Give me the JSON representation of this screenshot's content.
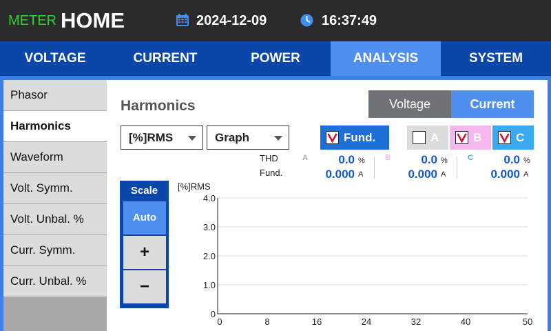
{
  "header": {
    "app": "METER",
    "title": "HOME",
    "date": "2024-12-09",
    "time": "16:37:49"
  },
  "tabs": [
    {
      "label": "VOLTAGE"
    },
    {
      "label": "CURRENT"
    },
    {
      "label": "POWER"
    },
    {
      "label": "ANALYSIS",
      "active": true
    },
    {
      "label": "SYSTEM"
    }
  ],
  "sidebar": {
    "items": [
      {
        "label": "Phasor"
      },
      {
        "label": "Harmonics",
        "active": true
      },
      {
        "label": "Waveform"
      },
      {
        "label": "Volt. Symm."
      },
      {
        "label": "Volt. Unbal. %"
      },
      {
        "label": "Curr. Symm."
      },
      {
        "label": "Curr. Unbal. %"
      }
    ]
  },
  "page": {
    "title": "Harmonics",
    "toggle": {
      "voltage": "Voltage",
      "current": "Current",
      "selected": "Current"
    }
  },
  "controls": {
    "measure_select": "[%]RMS",
    "view_select": "Graph",
    "checks": [
      {
        "label": "Fund.",
        "checked": true,
        "color": "#1f6fd8"
      },
      {
        "label": "A",
        "checked": false,
        "color": "#dcdcdc"
      },
      {
        "label": "B",
        "checked": true,
        "color": "#f6b8f0"
      },
      {
        "label": "C",
        "checked": true,
        "color": "#39aaf0"
      }
    ]
  },
  "readout": {
    "thd_label": "THD",
    "fund_label": "Fund.",
    "phases": [
      {
        "name": "A",
        "thd": "0.0",
        "thd_unit": "%",
        "fund": "0.000",
        "fund_unit": "A",
        "color": "#aaaaaa"
      },
      {
        "name": "B",
        "thd": "0.0",
        "thd_unit": "%",
        "fund": "0.000",
        "fund_unit": "A",
        "color": "#f4b6ef"
      },
      {
        "name": "C",
        "thd": "0.0",
        "thd_unit": "%",
        "fund": "0.000",
        "fund_unit": "A",
        "color": "#39aaf0"
      }
    ]
  },
  "scale": {
    "title": "Scale",
    "auto": "Auto",
    "plus": "+",
    "minus": "−"
  },
  "chart_data": {
    "type": "bar",
    "ylabel": "[%]RMS",
    "ylim": [
      0,
      4.0
    ],
    "yticks": [
      "0",
      "1.0",
      "2.0",
      "3.0",
      "4.0"
    ],
    "xlim": [
      0,
      50
    ],
    "xticks": [
      "0",
      "8",
      "16",
      "24",
      "32",
      "40",
      "50"
    ],
    "grid": true,
    "series": []
  }
}
